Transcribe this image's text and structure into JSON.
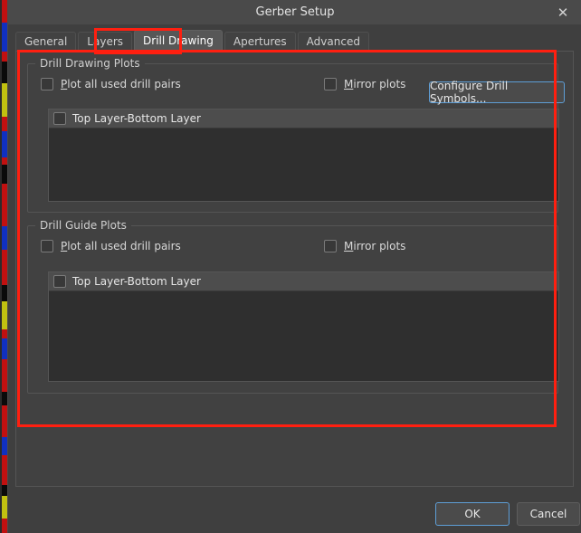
{
  "window": {
    "title": "Gerber Setup",
    "close_icon": "close-icon",
    "close_glyph": "✕"
  },
  "tabs": [
    {
      "label": "General",
      "active": false
    },
    {
      "label": "Layers",
      "active": false
    },
    {
      "label": "Drill Drawing",
      "active": true
    },
    {
      "label": "Apertures",
      "active": false
    },
    {
      "label": "Advanced",
      "active": false
    }
  ],
  "drill_drawing_plots": {
    "group_title": "Drill Drawing Plots",
    "plot_all_mnemonic": "P",
    "plot_all_rest": "lot all used drill pairs",
    "plot_all_checked": false,
    "mirror_mnemonic": "M",
    "mirror_rest": "irror plots",
    "mirror_checked": false,
    "configure_button": "Configure Drill Symbols...",
    "list_items": [
      {
        "label": "Top Layer-Bottom Layer",
        "checked": false
      }
    ]
  },
  "drill_guide_plots": {
    "group_title": "Drill Guide Plots",
    "plot_all_mnemonic": "P",
    "plot_all_rest": "lot all used drill pairs",
    "plot_all_checked": false,
    "mirror_mnemonic": "M",
    "mirror_rest": "irror plots",
    "mirror_checked": false,
    "list_items": [
      {
        "label": "Top Layer-Bottom Layer",
        "checked": false
      }
    ]
  },
  "footer": {
    "ok_label": "OK",
    "cancel_label": "Cancel"
  },
  "colors": {
    "window_bg": "#3f3f3f",
    "titlebar_bg": "#4a4a4a",
    "panel_bg": "#414141",
    "listbox_bg": "#2f2f2f",
    "listhead_bg": "#4d4d4d",
    "text": "#d8d8d8",
    "focus_border": "#5e9ed6",
    "annotation_red": "#ff1f10"
  },
  "annotations": [
    {
      "name": "tab-highlight",
      "target": "Drill Drawing"
    },
    {
      "name": "panel-highlight",
      "target": "Drill Drawing tab panel"
    }
  ]
}
